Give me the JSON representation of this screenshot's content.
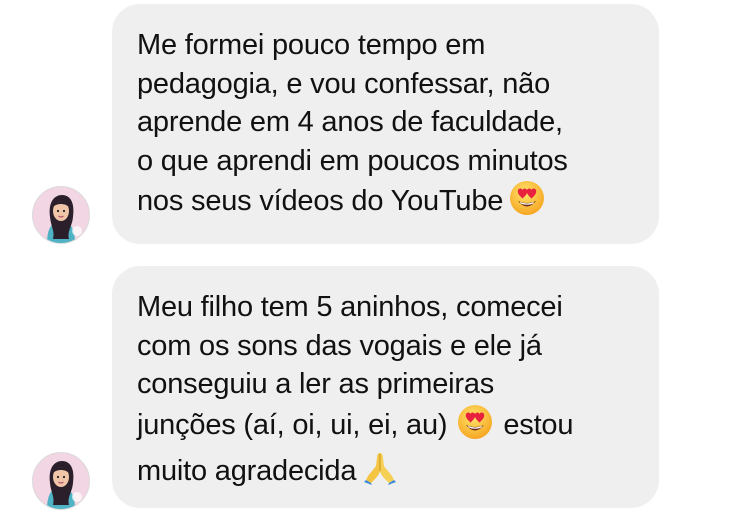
{
  "messages": [
    {
      "lines": [
        "Me formei pouco tempo em",
        "pedagogia, e vou confessar, não",
        "aprende em 4 anos de faculdade,",
        "o que aprendi em poucos minutos",
        "nos seus vídeos do YouTube"
      ],
      "end_emoji": "heart-eyes-emoji"
    },
    {
      "lines": [
        "Meu filho tem 5 aninhos, comecei",
        "com os sons das vogais e ele já",
        "conseguiu a ler as primeiras",
        "junções (aí, oi, ui, ei, au)",
        "estou",
        "muito agradecida"
      ],
      "inline_emoji": "heart-eyes-emoji",
      "end_emoji": "folded-hands-emoji"
    }
  ],
  "colors": {
    "bubble": "#efefef",
    "text": "#111111",
    "background": "#ffffff"
  }
}
